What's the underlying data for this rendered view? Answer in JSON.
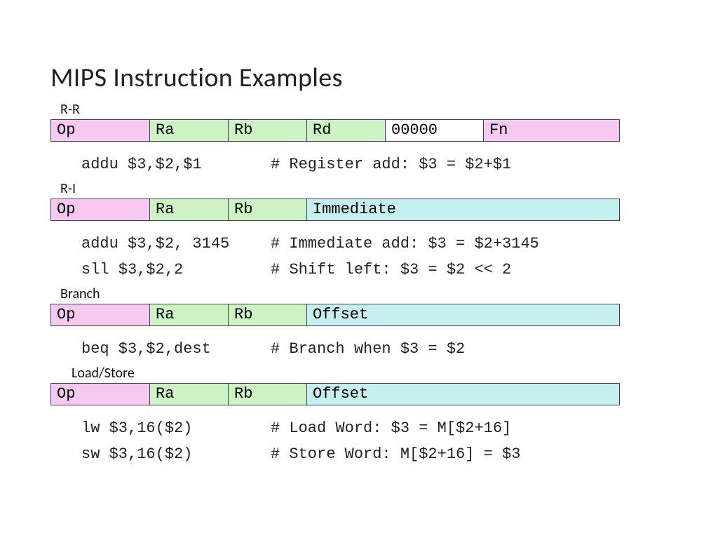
{
  "title": "MIPS Instruction Examples",
  "sections": {
    "rr": {
      "label": "R-R",
      "cells": [
        "Op",
        "Ra",
        "Rb",
        "Rd",
        "00000",
        "Fn"
      ]
    },
    "ri": {
      "label": "R-I",
      "cells": [
        "Op",
        "Ra",
        "Rb",
        "Immediate"
      ]
    },
    "branch": {
      "label": "Branch",
      "cells": [
        "Op",
        "Ra",
        "Rb",
        "Offset"
      ]
    },
    "ls": {
      "label": "Load/Store",
      "cells": [
        "Op",
        "Ra",
        "Rb",
        "Offset"
      ]
    }
  },
  "examples": {
    "rr1": {
      "inst": "addu $3,$2,$1",
      "cmt": "# Register add: $3 = $2+$1"
    },
    "ri1": {
      "inst": "addu $3,$2, 3145",
      "cmt": "# Immediate add: $3 = $2+3145"
    },
    "ri2": {
      "inst": "sll $3,$2,2",
      "cmt": "# Shift left: $3 = $2 << 2"
    },
    "br1": {
      "inst": "beq $3,$2,dest",
      "cmt": "# Branch when $3 = $2"
    },
    "ls1": {
      "inst": "lw $3,16($2)",
      "cmt": "# Load Word: $3 = M[$2+16]"
    },
    "ls2": {
      "inst": "sw $3,16($2)",
      "cmt": "# Store Word: M[$2+16] = $3"
    }
  }
}
